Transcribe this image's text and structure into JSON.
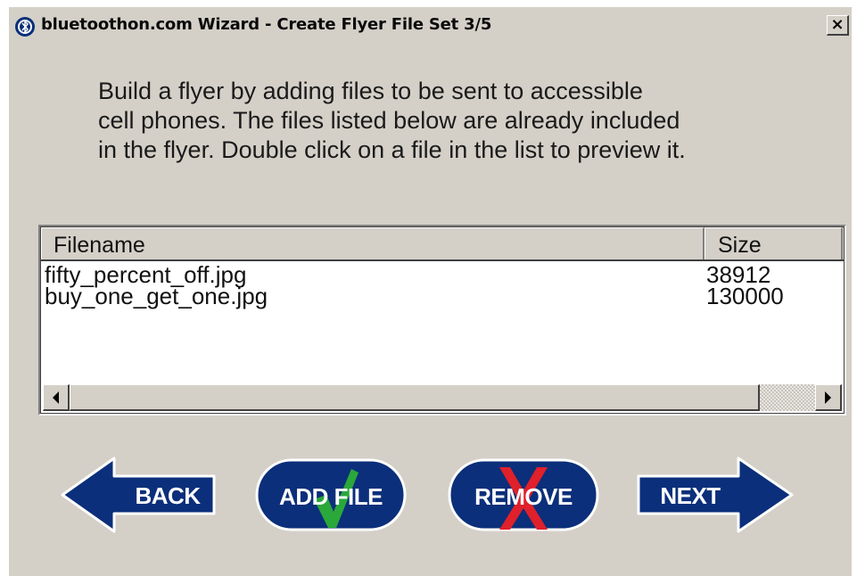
{
  "window": {
    "title": "bluetoothon.com Wizard - Create Flyer File Set 3/5",
    "close_glyph": "×"
  },
  "instructions": {
    "line1": "Build a flyer by adding files to be sent to accessible",
    "line2": "cell phones. The files listed below are already included",
    "line3": "in the flyer. Double click on a file in the list to preview it."
  },
  "file_list": {
    "columns": [
      "Filename",
      "Size"
    ],
    "rows": [
      {
        "filename": "fifty_percent_off.jpg",
        "size": "38912"
      },
      {
        "filename": "buy_one_get_one.jpg",
        "size": "130000"
      }
    ]
  },
  "buttons": {
    "back": "BACK",
    "add_file": "ADD FILE",
    "remove": "REMOVE",
    "next": "NEXT"
  },
  "colors": {
    "window_bg": "#d4d0c8",
    "button_blue": "#0b2f7a",
    "check_green": "#2aa83a",
    "remove_red": "#e0202a"
  },
  "icons": {
    "app": "bluetooth-app-icon",
    "add_overlay": "check-mark-icon",
    "remove_overlay": "red-x-icon"
  }
}
